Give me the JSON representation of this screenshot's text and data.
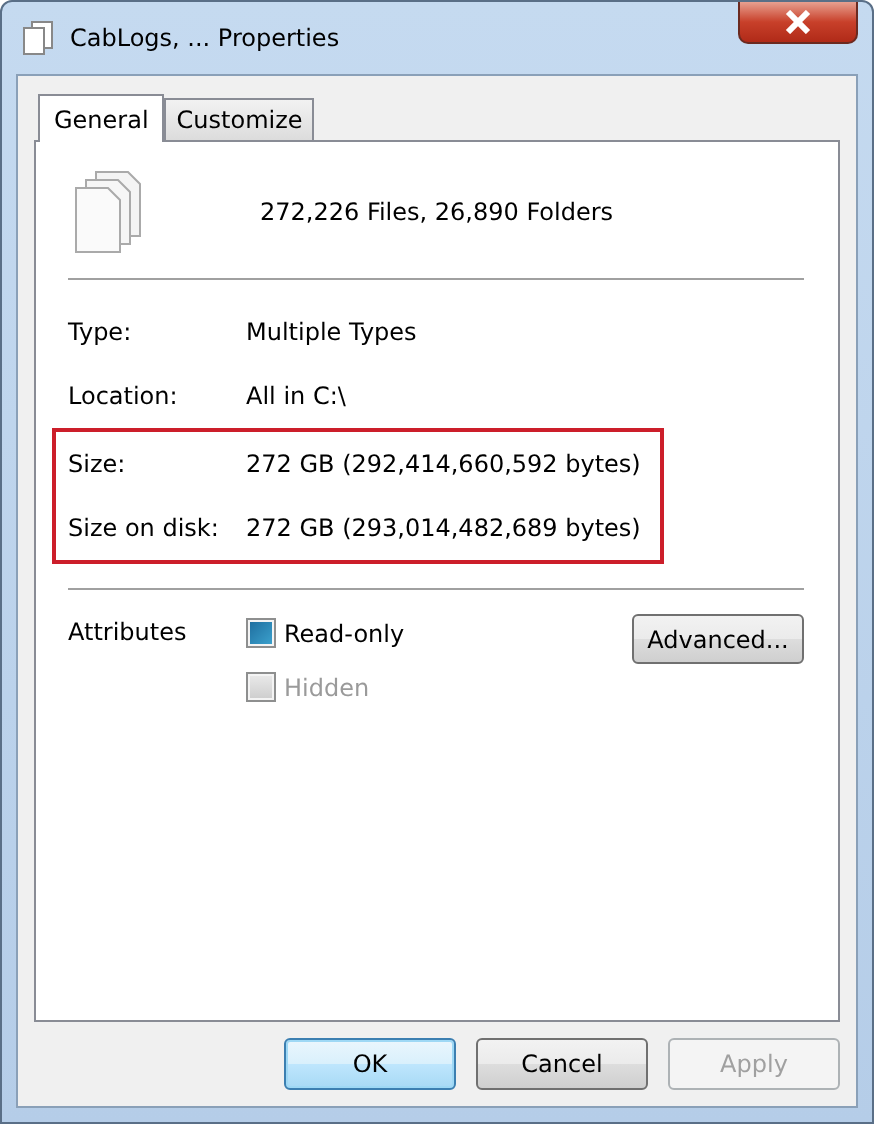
{
  "window": {
    "title": "CabLogs, ... Properties"
  },
  "tabs": [
    {
      "label": "General",
      "selected": true
    },
    {
      "label": "Customize",
      "selected": false
    }
  ],
  "summary": "272,226 Files, 26,890 Folders",
  "details": [
    {
      "label": "Type:",
      "value": "Multiple Types",
      "highlighted": false
    },
    {
      "label": "Location:",
      "value": "All in C:\\",
      "highlighted": false
    },
    {
      "label": "Size:",
      "value": "272 GB (292,414,660,592 bytes)",
      "highlighted": true
    },
    {
      "label": "Size on disk:",
      "value": "272 GB (293,014,482,689 bytes)",
      "highlighted": true
    }
  ],
  "attributes": {
    "label": "Attributes",
    "options": [
      {
        "label": "Read-only",
        "indeterminate": true,
        "disabled": false
      },
      {
        "label": "Hidden",
        "indeterminate": false,
        "disabled": true
      }
    ],
    "advanced_button": "Advanced..."
  },
  "buttons": [
    {
      "label": "OK",
      "default": true,
      "disabled": false
    },
    {
      "label": "Cancel",
      "default": false,
      "disabled": false
    },
    {
      "label": "Apply",
      "default": false,
      "disabled": true
    }
  ]
}
